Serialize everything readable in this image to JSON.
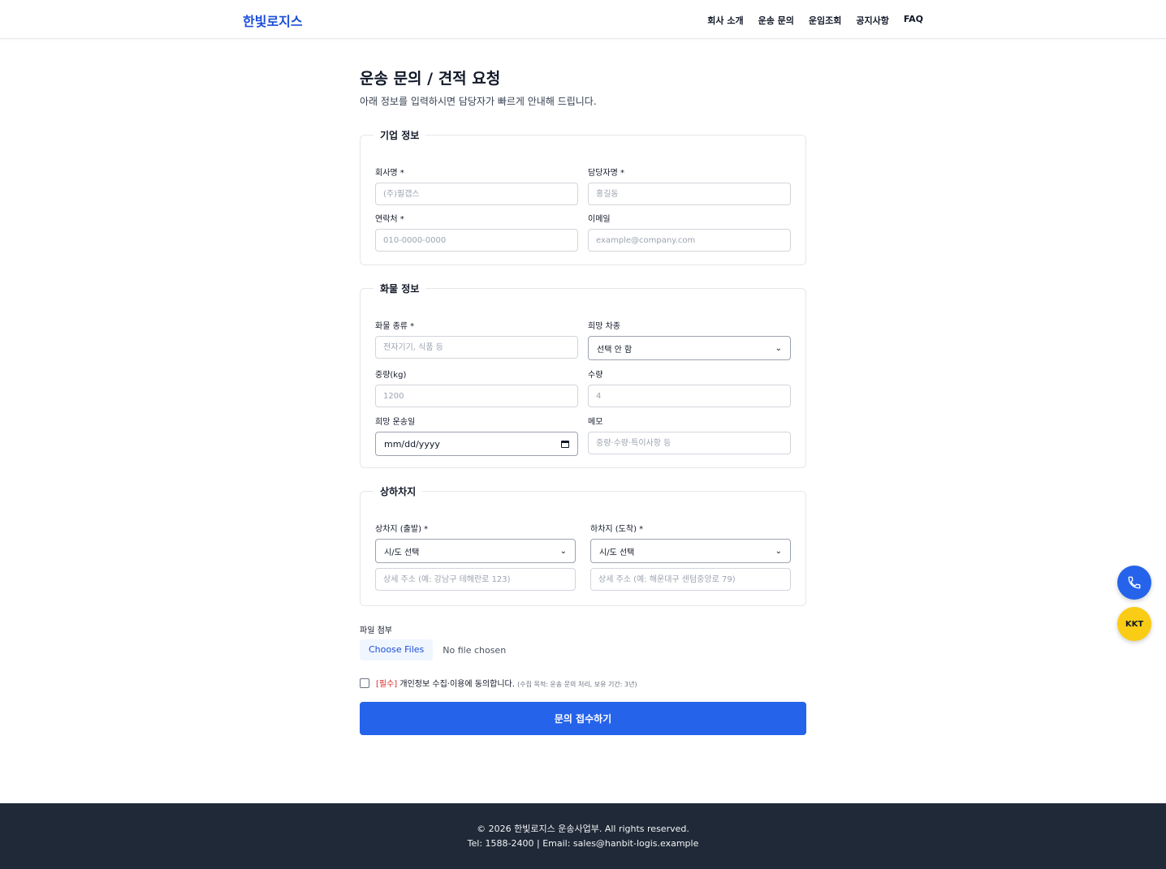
{
  "header": {
    "logo": "한빛로지스",
    "nav": [
      "회사 소개",
      "운송 문의",
      "운임조회",
      "공지사항",
      "FAQ"
    ]
  },
  "page": {
    "title": "운송 문의 / 견적 요청",
    "subtitle": "아래 정보를 입력하시면 담당자가 빠르게 안내해 드립니다."
  },
  "company": {
    "legend": "기업 정보",
    "company_name": {
      "label": "회사명 *",
      "placeholder": "(주)필갭스"
    },
    "contact_name": {
      "label": "담당자명 *",
      "placeholder": "홍길동"
    },
    "phone": {
      "label": "연락처 *",
      "placeholder": "010-0000-0000"
    },
    "email": {
      "label": "이메일",
      "placeholder": "example@company.com"
    }
  },
  "cargo": {
    "legend": "화물 정보",
    "type": {
      "label": "화물 종류 *",
      "placeholder": "전자기기, 식품 등"
    },
    "vehicle": {
      "label": "희망 차종",
      "value": "선택 안 함"
    },
    "weight": {
      "label": "중량(kg)",
      "placeholder": "1200"
    },
    "quantity": {
      "label": "수량",
      "placeholder": "4"
    },
    "date": {
      "label": "희망 운송일",
      "value": "mm/dd/yyyy"
    },
    "memo": {
      "label": "메모",
      "placeholder": "중량·수량·특이사항 등"
    }
  },
  "locations": {
    "legend": "상하차지",
    "origin": {
      "label": "상차지 (출발) *",
      "value": "시/도 선택",
      "detail_placeholder": "상세 주소 (예: 강남구 테헤란로 123)"
    },
    "destination": {
      "label": "하차지 (도착) *",
      "value": "시/도 선택",
      "detail_placeholder": "상세 주소 (예: 해운대구 센텀중앙로 79)"
    }
  },
  "file": {
    "label": "파일 첨부",
    "button": "Choose Files",
    "status": "No file chosen"
  },
  "consent": {
    "required": "[필수]",
    "text": "개인정보 수집·이용에 동의합니다.",
    "note": "(수집 목적: 운송 문의 처리, 보유 기간: 3년)"
  },
  "submit": {
    "label": "문의 접수하기"
  },
  "footer": {
    "copyright": "© 2026 한빛로지스 운송사업부. All rights reserved.",
    "contact": "Tel: 1588-2400 | Email: sales@hanbit-logis.example"
  },
  "fab": {
    "kakao": "KKT"
  },
  "colors": {
    "primary": "#2563eb",
    "logo": "#1d4ed8",
    "footer": "#1f2937",
    "kakao": "#facc15",
    "required": "#dc2626"
  }
}
